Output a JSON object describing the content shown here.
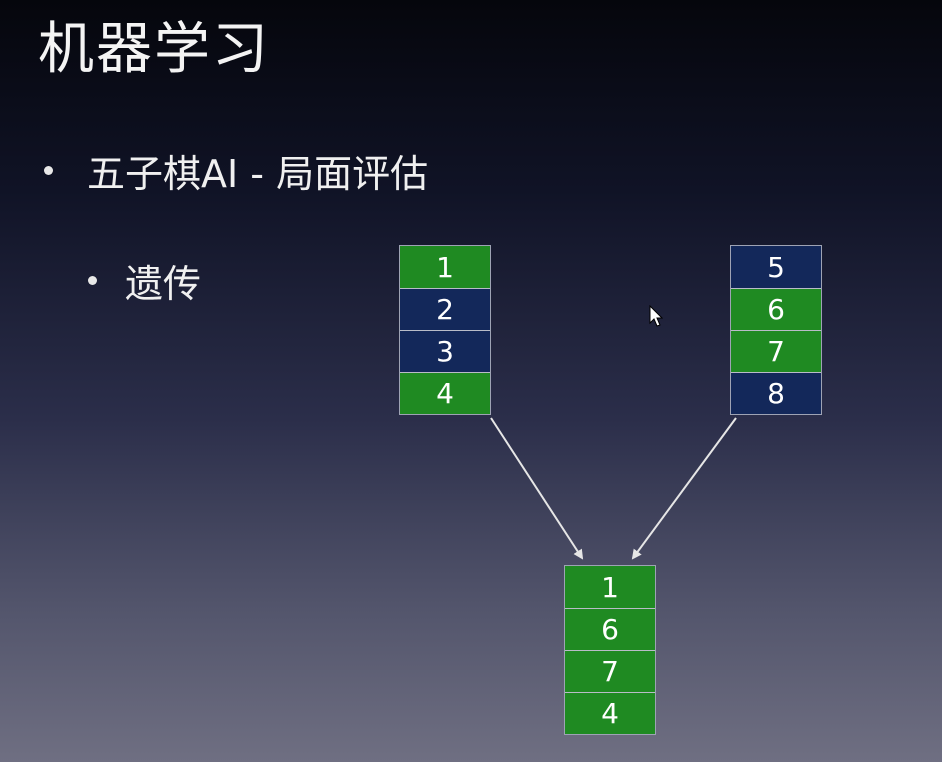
{
  "title": "机器学习",
  "bullets": [
    {
      "text": "五子棋AI - 局面评估"
    },
    {
      "text": "遗传"
    }
  ],
  "diagram": {
    "parent_a": [
      {
        "label": "1",
        "color": "#1f8a22"
      },
      {
        "label": "2",
        "color": "#13285a"
      },
      {
        "label": "3",
        "color": "#13285a"
      },
      {
        "label": "4",
        "color": "#1f8a22"
      }
    ],
    "parent_b": [
      {
        "label": "5",
        "color": "#13285a"
      },
      {
        "label": "6",
        "color": "#1f8a22"
      },
      {
        "label": "7",
        "color": "#1f8a22"
      },
      {
        "label": "8",
        "color": "#13285a"
      }
    ],
    "child": [
      {
        "label": "1",
        "color": "#1f8a22"
      },
      {
        "label": "6",
        "color": "#1f8a22"
      },
      {
        "label": "7",
        "color": "#1f8a22"
      },
      {
        "label": "4",
        "color": "#1f8a22"
      }
    ]
  },
  "icons": {
    "cursor": "mouse-pointer-icon",
    "arrow": "arrow-icon"
  },
  "colors": {
    "gene_green": "#1f8a22",
    "gene_navy": "#13285a",
    "arrow": "#e6e6e6"
  }
}
